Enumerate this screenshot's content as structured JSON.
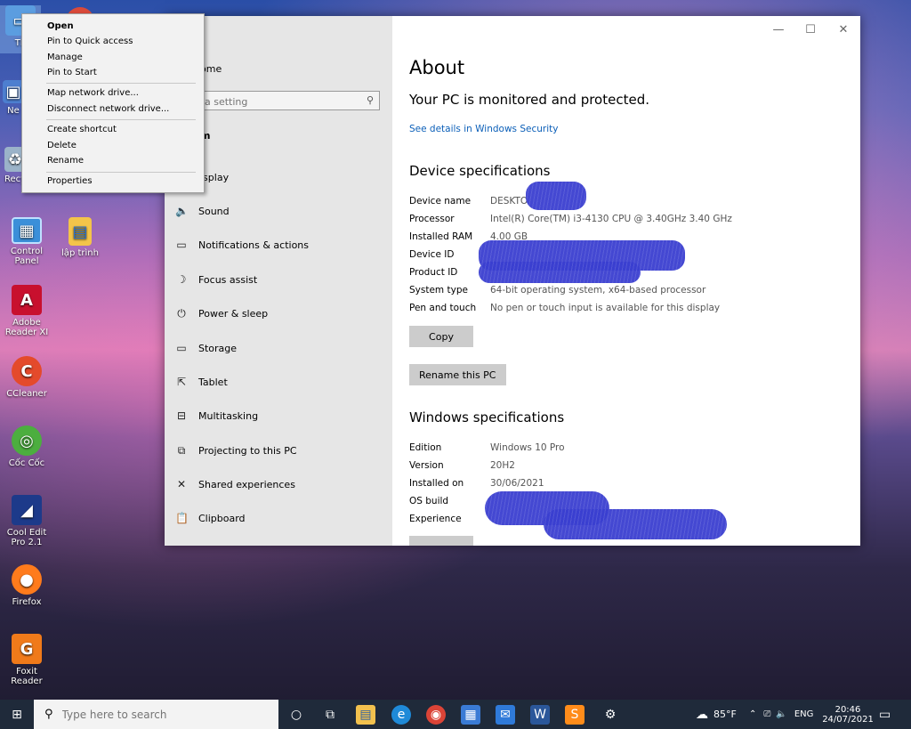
{
  "desktop": {
    "icons": [
      {
        "label": "Th",
        "name": "this-pc"
      },
      {
        "label": "Ne",
        "name": "network"
      },
      {
        "label": "Recy",
        "name": "recycle-bin"
      },
      {
        "label": "Control Panel",
        "name": "control-panel"
      },
      {
        "label": "lập trình",
        "name": "lap-trinh-folder"
      },
      {
        "label": "Adobe Reader XI",
        "name": "adobe-reader"
      },
      {
        "label": "CCleaner",
        "name": "ccleaner"
      },
      {
        "label": "Cốc Cốc",
        "name": "coc-coc"
      },
      {
        "label": "Cool Edit Pro 2.1",
        "name": "cool-edit-pro"
      },
      {
        "label": "Firefox",
        "name": "firefox"
      },
      {
        "label": "Foxit Reader",
        "name": "foxit-reader"
      }
    ]
  },
  "context_menu": {
    "items": [
      "Open",
      "Pin to Quick access",
      "Manage",
      "Pin to Start",
      "Map network drive...",
      "Disconnect network drive...",
      "Create shortcut",
      "Delete",
      "Rename",
      "Properties"
    ]
  },
  "settings": {
    "nav": {
      "home": "ome",
      "search_placeholder": "a setting",
      "section": "m",
      "items": [
        "isplay",
        "Sound",
        "Notifications & actions",
        "Focus assist",
        "Power & sleep",
        "Storage",
        "Tablet",
        "Multitasking",
        "Projecting to this PC",
        "Shared experiences",
        "Clipboard"
      ]
    },
    "about": {
      "title": "About",
      "status": "Your PC is monitored and protected.",
      "security_link": "See details in Windows Security",
      "device_heading": "Device specifications",
      "device": [
        {
          "k": "Device name",
          "v": "DESKTO"
        },
        {
          "k": "Processor",
          "v": "Intel(R) Core(TM) i3-4130 CPU @ 3.40GHz   3.40 GHz"
        },
        {
          "k": "Installed RAM",
          "v": "4.00 GB"
        },
        {
          "k": "Device ID",
          "v": ""
        },
        {
          "k": "Product ID",
          "v": ""
        },
        {
          "k": "System type",
          "v": "64-bit operating system, x64-based processor"
        },
        {
          "k": "Pen and touch",
          "v": "No pen or touch input is available for this display"
        }
      ],
      "copy_button": "Copy",
      "rename_button": "Rename this PC",
      "windows_heading": "Windows specifications",
      "windows": [
        {
          "k": "Edition",
          "v": "Windows 10 Pro"
        },
        {
          "k": "Version",
          "v": "20H2"
        },
        {
          "k": "Installed on",
          "v": "30/06/2021"
        },
        {
          "k": "OS build",
          "v": ""
        },
        {
          "k": "Experience",
          "v": ""
        }
      ]
    }
  },
  "taskbar": {
    "search_placeholder": "Type here to search",
    "weather": "85°F",
    "language": "ENG",
    "time": "20:46",
    "date": "24/07/2021"
  }
}
